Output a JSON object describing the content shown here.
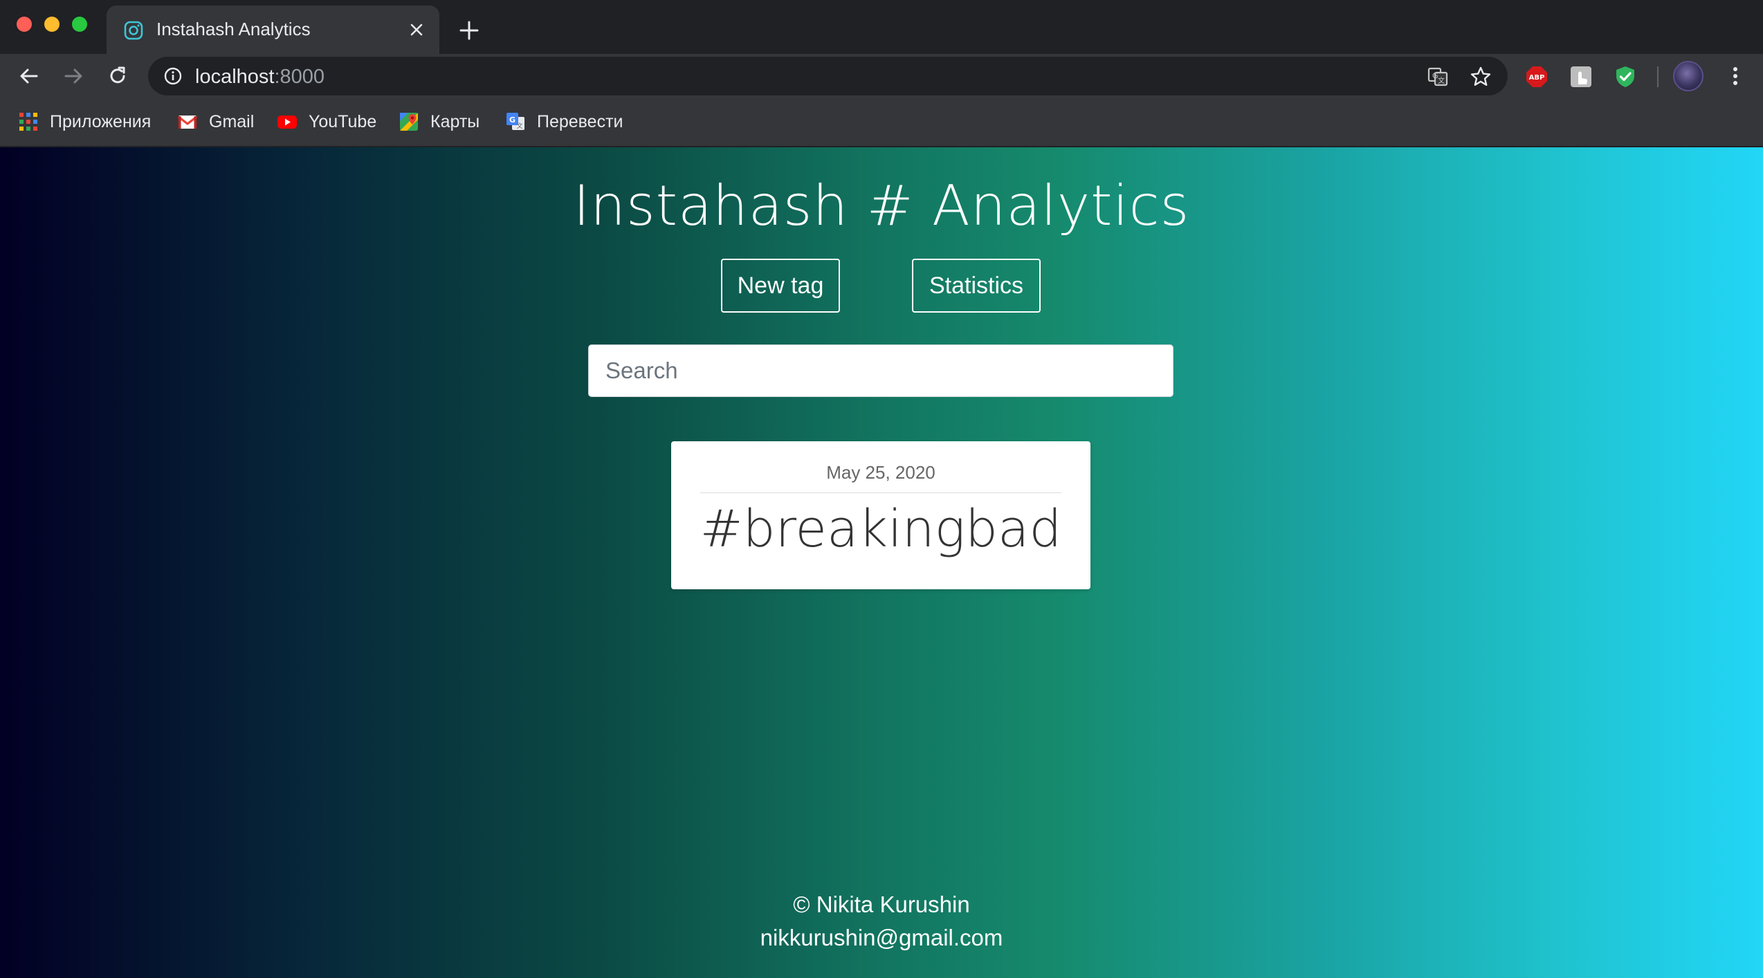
{
  "browser": {
    "tab": {
      "title": "Instahash Analytics",
      "favicon": "instagram-icon"
    },
    "address_bar": {
      "host": "localhost",
      "port": ":8000"
    },
    "bookmarks": [
      {
        "label": "Приложения",
        "icon": "apps-grid-icon"
      },
      {
        "label": "Gmail",
        "icon": "gmail-icon"
      },
      {
        "label": "YouTube",
        "icon": "youtube-icon"
      },
      {
        "label": "Карты",
        "icon": "maps-icon"
      },
      {
        "label": "Перевести",
        "icon": "translate-icon"
      }
    ],
    "extensions": [
      {
        "name": "adblock-plus-icon",
        "label": "ABP"
      },
      {
        "name": "touch-extension-icon"
      },
      {
        "name": "shield-check-icon"
      }
    ]
  },
  "page": {
    "title": "Instahash # Analytics",
    "nav": {
      "new_tag": "New tag",
      "statistics": "Statistics"
    },
    "search": {
      "placeholder": "Search",
      "value": ""
    },
    "cards": [
      {
        "date": "May 25, 2020",
        "tag": "#breakingbad"
      }
    ],
    "footer": {
      "author": "© Nikita Kurushin",
      "email": "nikkurushin@gmail.com"
    }
  },
  "colors": {
    "gradient_start": "#020024",
    "gradient_mid": "#127560",
    "gradient_end": "#22d6f7",
    "chrome_dark": "#202124",
    "chrome_toolbar": "#35363a"
  }
}
